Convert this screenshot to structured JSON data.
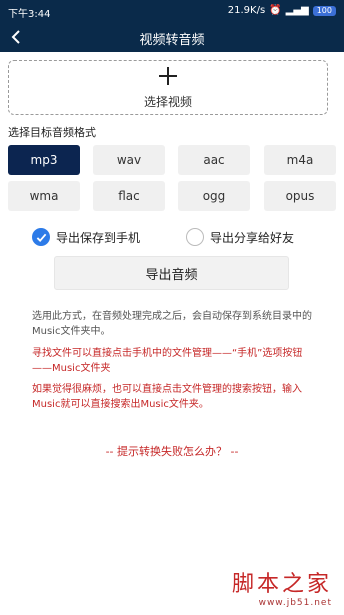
{
  "status_bar": {
    "time": "下午3:44",
    "network_speed": "21.9K/s",
    "battery_label": "100"
  },
  "app_bar": {
    "title": "视频转音频"
  },
  "select_video": {
    "label": "选择视频"
  },
  "format_section": {
    "label": "选择目标音频格式",
    "formats": [
      "mp3",
      "wav",
      "aac",
      "m4a",
      "wma",
      "flac",
      "ogg",
      "opus"
    ],
    "selected": "mp3"
  },
  "export_options": {
    "save_to_phone": "导出保存到手机",
    "share_to_friends": "导出分享给好友",
    "save_to_phone_checked": true,
    "share_to_friends_checked": false
  },
  "export_button": {
    "label": "导出音频"
  },
  "info": {
    "gray_text": "选用此方式，在音频处理完成之后，会自动保存到系统目录中的Music文件夹中。",
    "red_text_1": "寻找文件可以直接点击手机中的文件管理——“手机”选项按钮——Music文件夹",
    "red_text_2": "如果觉得很麻烦，也可以直接点击文件管理的搜索按钮，输入Music就可以直接搜索出Music文件夹。"
  },
  "help_link": "-- 提示转换失败怎么办？ --",
  "watermark": {
    "title": "脚本之家",
    "url": "www.jb51.net"
  },
  "colors": {
    "header_bg": "#0a2a4a",
    "selected_format_bg": "#0c2550",
    "checkbox_checked": "#2d7be8",
    "warning_red": "#c62828"
  },
  "icons": {
    "back": "back-arrow-icon",
    "add": "plus-icon",
    "check": "check-icon"
  }
}
